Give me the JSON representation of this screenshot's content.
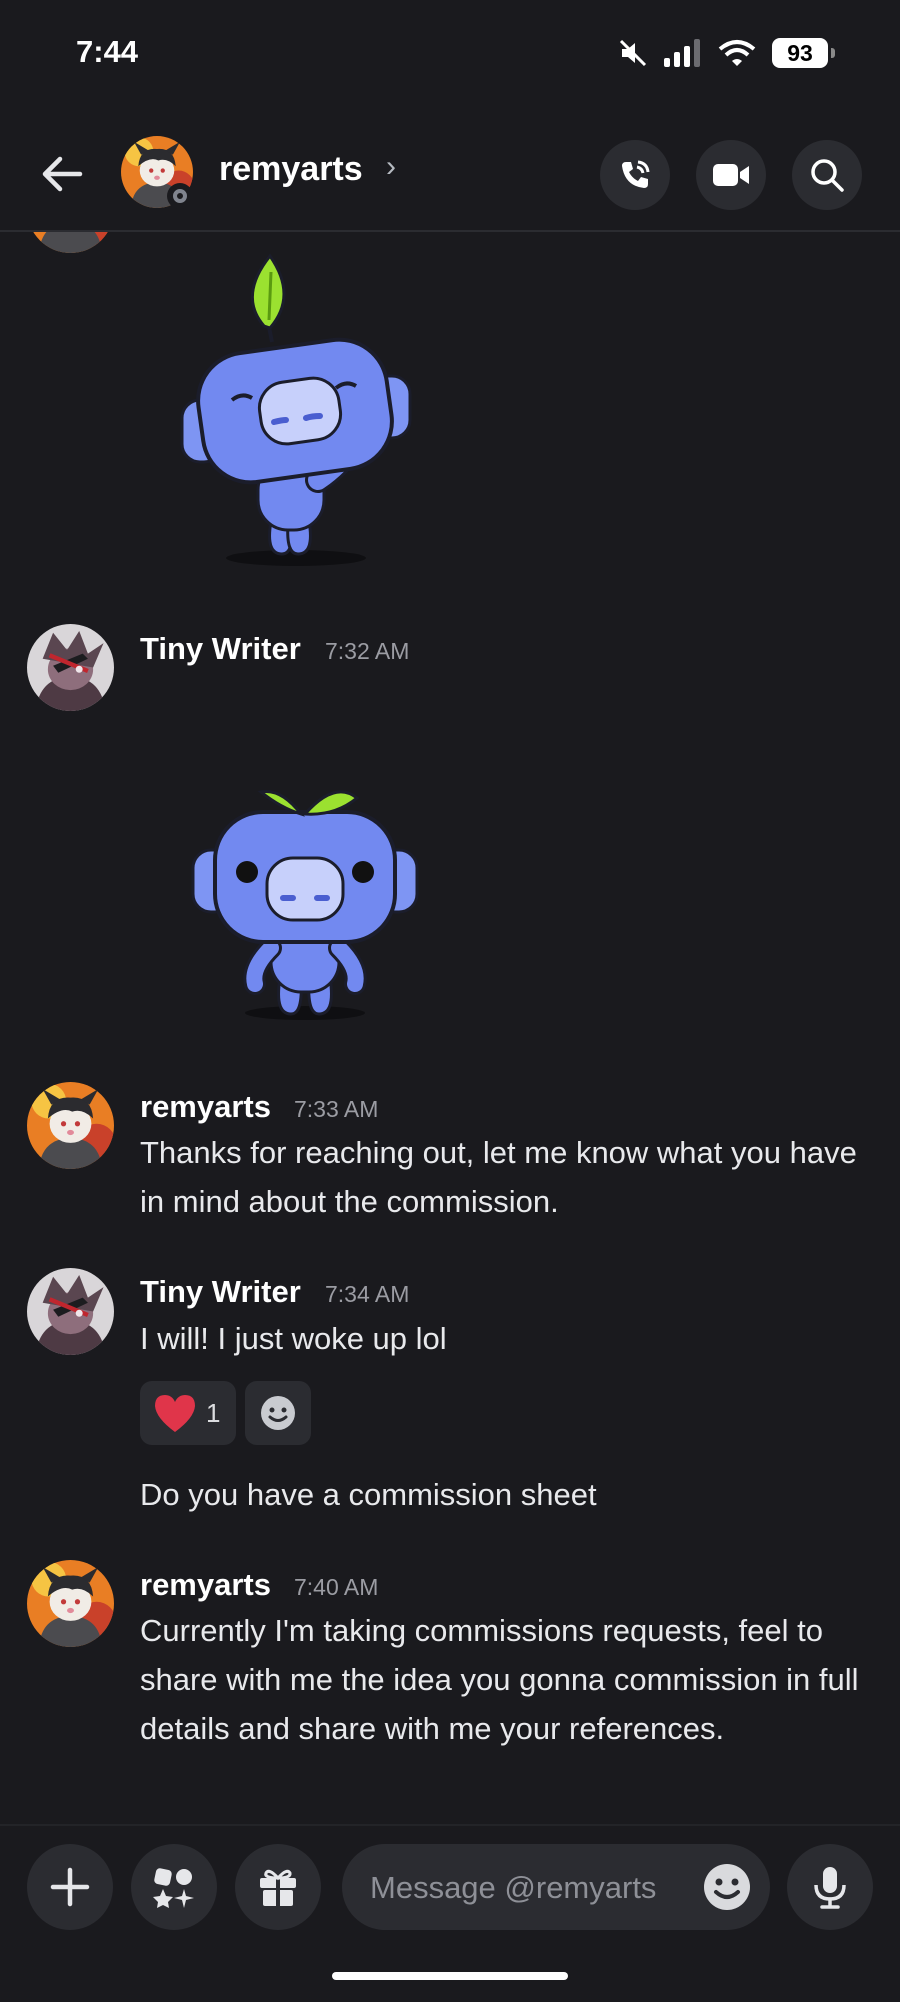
{
  "status_bar": {
    "time": "7:44",
    "battery": "93",
    "icons": [
      "mute-icon",
      "signal-icon",
      "wifi-icon",
      "battery-icon"
    ]
  },
  "header": {
    "title": "remyarts",
    "chevron": "›",
    "icons": [
      "back-arrow-icon",
      "voice-call-icon",
      "video-call-icon",
      "search-icon"
    ]
  },
  "messages": [
    {
      "author": "Tiny Writer",
      "time": "7:32 AM",
      "sticker": "wumpus-standing-sticker"
    },
    {
      "author": "remyarts",
      "time": "7:33 AM",
      "text": "Thanks for reaching out, let me know what you have in mind about the commission."
    },
    {
      "author": "Tiny Writer",
      "time": "7:34 AM",
      "text": "I will! I just woke up lol",
      "reaction": {
        "emoji": "red-heart",
        "count": "1"
      },
      "followup": "Do you have a commission sheet"
    },
    {
      "author": "remyarts",
      "time": "7:40 AM",
      "text": "Currently I'm taking commissions requests, feel to share with me the idea you gonna commission in full details and share with me your references."
    }
  ],
  "top_sticker": "wumpus-waving-sticker",
  "composer": {
    "placeholder": "Message @remyarts",
    "icons": [
      "plus-icon",
      "apps-icon",
      "gift-icon",
      "emoji-icon",
      "microphone-icon"
    ]
  },
  "colors": {
    "background": "#1a1a1e",
    "surface": "#2b2c31",
    "wumpus": "#7289f0",
    "leaf": "#9be130",
    "heart": "#e0354a"
  }
}
